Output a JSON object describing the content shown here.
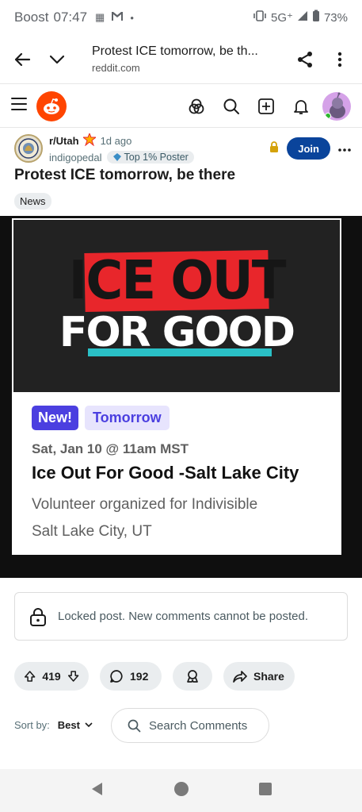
{
  "status_bar": {
    "carrier": "Boost",
    "time": "07:47",
    "network": "5G⁺",
    "battery": "73%"
  },
  "browser": {
    "title": "Protest ICE tomorrow, be th...",
    "url": "reddit.com"
  },
  "post": {
    "subreddit": "r/Utah",
    "age": "1d ago",
    "author": "indigopedal",
    "author_badge": "Top 1% Poster",
    "join_label": "Join",
    "title": "Protest ICE tomorrow, be there",
    "flair": "News"
  },
  "media": {
    "banner_line1": "ICE OUT",
    "banner_line2": "FOR GOOD",
    "badge_new": "New!",
    "badge_tomorrow": "Tomorrow",
    "event_date": "Sat, Jan 10 @ 11am MST",
    "event_title": "Ice Out For Good -Salt Lake City",
    "organizer": "Volunteer organized for Indivisible",
    "location": "Salt Lake City, UT"
  },
  "locked_notice": "Locked post. New comments cannot be posted.",
  "actions": {
    "votes": "419",
    "comments": "192",
    "share_label": "Share"
  },
  "sort": {
    "label": "Sort by:",
    "value": "Best"
  },
  "search_comments_placeholder": "Search Comments",
  "colors": {
    "reddit_orange": "#ff4500",
    "join_blue": "#0a449b",
    "event_purple": "#4b3fe0",
    "banner_red": "#e8262b",
    "banner_teal": "#2ac0c6"
  }
}
